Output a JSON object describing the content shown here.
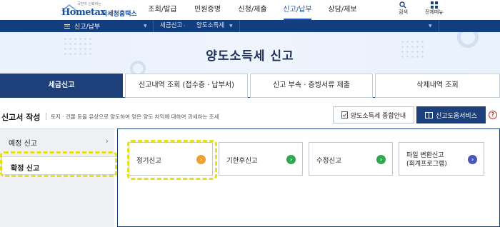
{
  "header": {
    "logo_tagline": "국민이 신뢰하는",
    "logo_text": "Hometax",
    "logo_sub": "국세청홈택스",
    "nav": [
      {
        "label": "조회/발급",
        "active": false
      },
      {
        "label": "민원증명",
        "active": false
      },
      {
        "label": "신청/제출",
        "active": false
      },
      {
        "label": "신고/납부",
        "active": true
      },
      {
        "label": "상담/제보",
        "active": false
      }
    ],
    "search_label": "검색",
    "all_menu_label": "전체메뉴"
  },
  "locbar": {
    "menu_label": "신고/납부",
    "crumbs": [
      "세금신고",
      "양도소득세"
    ]
  },
  "banner": {
    "title": "양도소득세  신고"
  },
  "tabs": [
    {
      "label": "세금신고",
      "active": true
    },
    {
      "label": "신고내역 조회 (접수증 · 납부서)",
      "active": false
    },
    {
      "label": "신고 부속 · 증빙서류 제출",
      "active": false
    },
    {
      "label": "삭제내역 조회",
      "active": false
    }
  ],
  "section": {
    "title": "신고서 작성",
    "desc": "토지 · 건물 등을 유상으로 양도하여 얻은 양도 차익에 대하여 과세하는 조세",
    "guide_button": "양도소득세 종합안내",
    "help_button": "신고도움서비스",
    "help_icon": "?"
  },
  "left_menu": [
    {
      "label": "예정 신고",
      "active": false
    },
    {
      "label": "확정 신고",
      "active": true
    }
  ],
  "cards": [
    {
      "label": "정기신고",
      "icon_color": "#f0a02c"
    },
    {
      "label": "기한후신고",
      "icon_color": "#2fa84f"
    },
    {
      "label": "수정신고",
      "icon_color": "#2fa84f"
    },
    {
      "label": "파일 변환신고",
      "label2": "(회계프로그램)",
      "icon_color": "#4a57b8"
    }
  ],
  "colors": {
    "primary": "#1d3f7a",
    "highlight": "#e4e11a"
  }
}
